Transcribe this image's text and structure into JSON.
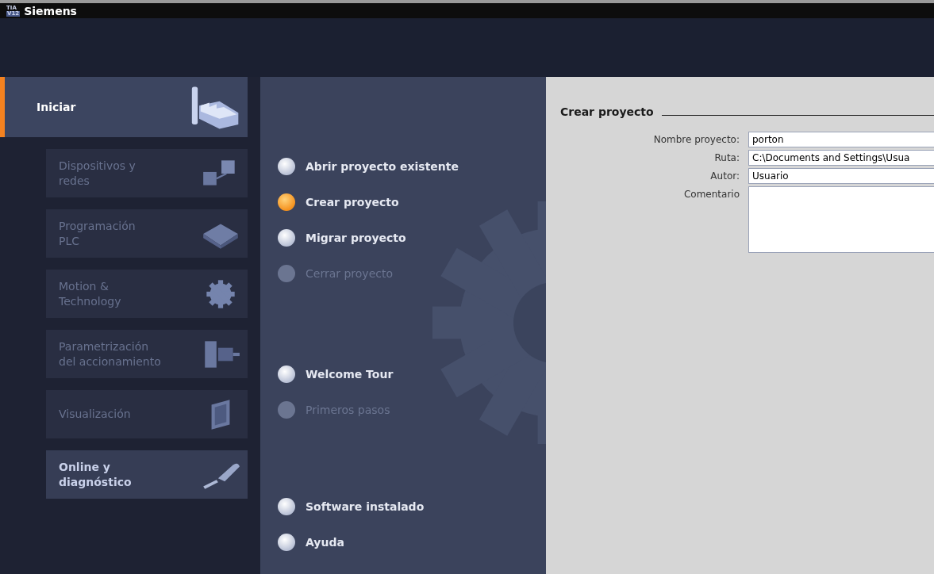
{
  "window": {
    "logo_top": "TIA",
    "logo_bottom": "V12",
    "title": "Siemens"
  },
  "portal": {
    "label": "Iniciar",
    "selected": true
  },
  "sidebar": {
    "items": [
      {
        "label": "Dispositivos y\nredes",
        "disabled": true
      },
      {
        "label": "Programación\nPLC",
        "disabled": true
      },
      {
        "label": "Motion &\nTechnology",
        "disabled": true
      },
      {
        "label": "Parametrización\ndel accionamiento",
        "disabled": true
      },
      {
        "label": "Visualización",
        "disabled": true
      },
      {
        "label": "Online y\ndiagnóstico",
        "disabled": false
      }
    ]
  },
  "actions": [
    [
      {
        "label": "Abrir proyecto existente",
        "selected": false,
        "disabled": false
      },
      {
        "label": "Crear proyecto",
        "selected": true,
        "disabled": false
      },
      {
        "label": "Migrar proyecto",
        "selected": false,
        "disabled": false
      },
      {
        "label": "Cerrar proyecto",
        "selected": false,
        "disabled": true
      }
    ],
    [
      {
        "label": "Welcome Tour",
        "selected": false,
        "disabled": false
      },
      {
        "label": "Primeros pasos",
        "selected": false,
        "disabled": true
      }
    ],
    [
      {
        "label": "Software instalado",
        "selected": false,
        "disabled": false
      },
      {
        "label": "Ayuda",
        "selected": false,
        "disabled": false
      }
    ]
  ],
  "form": {
    "heading": "Crear proyecto",
    "fields": [
      {
        "label": "Nombre proyecto:",
        "value": "porton",
        "kind": "text"
      },
      {
        "label": "Ruta:",
        "value": "C:\\Documents and Settings\\Usua",
        "kind": "text"
      },
      {
        "label": "Autor:",
        "value": "Usuario",
        "kind": "text"
      },
      {
        "label": "Comentario",
        "kind": "multiline"
      }
    ]
  }
}
